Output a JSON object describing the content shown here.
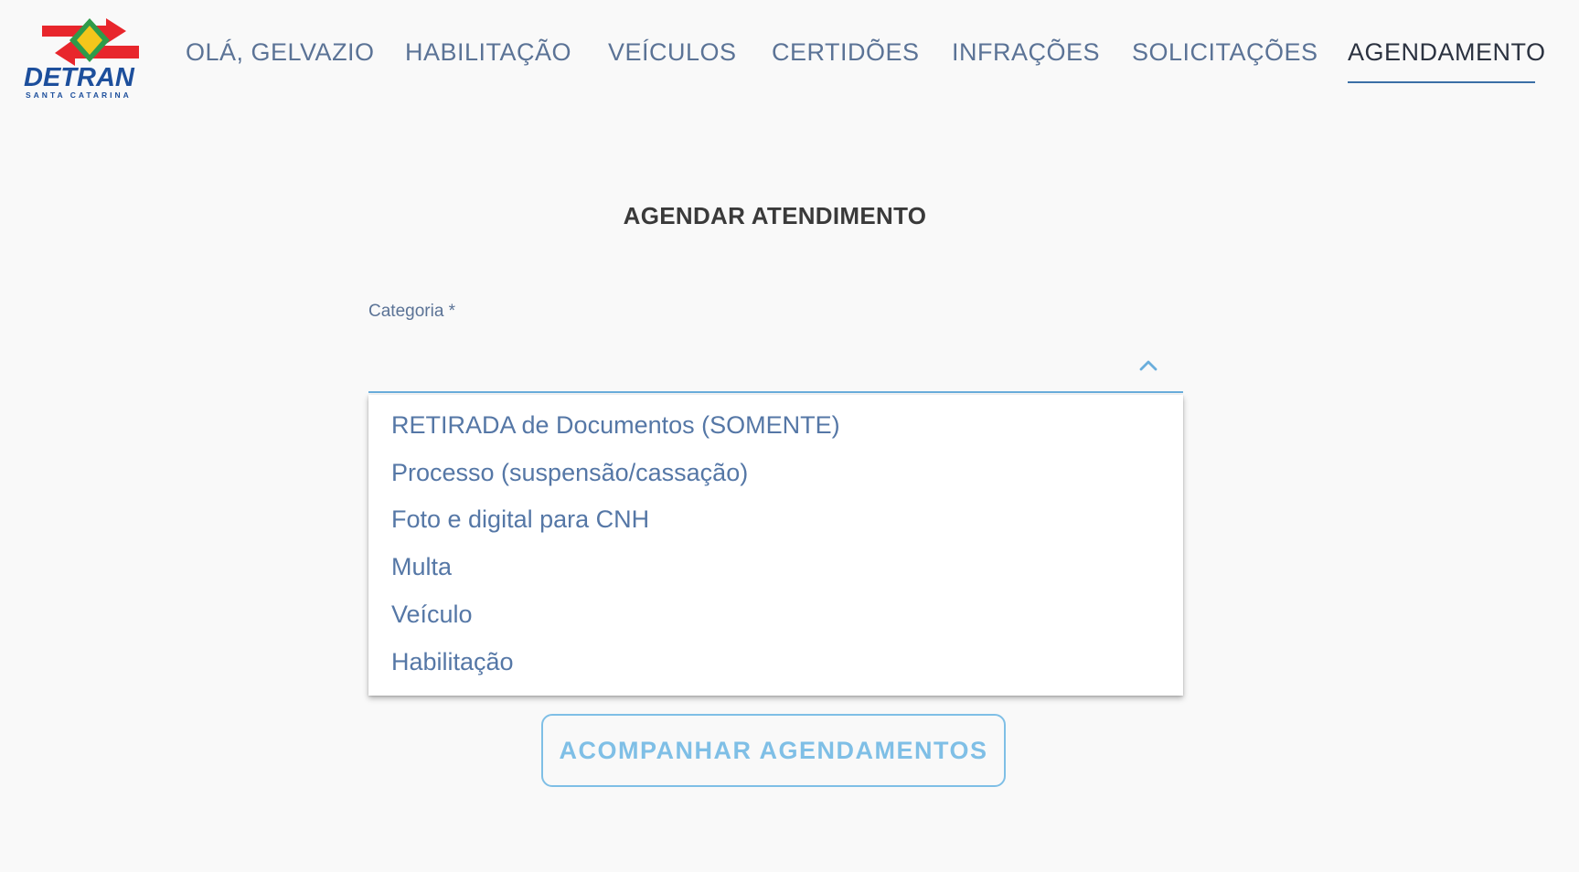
{
  "header": {
    "logo": {
      "brand_text": "DETRAN",
      "subtitle_text": "SANTA CATARINA"
    },
    "nav": {
      "items": [
        {
          "label": "OLÁ, GELVAZIO"
        },
        {
          "label": "HABILITAÇÃO"
        },
        {
          "label": "VEÍCULOS"
        },
        {
          "label": "CERTIDÕES"
        },
        {
          "label": "INFRAÇÕES"
        },
        {
          "label": "SOLICITAÇÕES"
        },
        {
          "label": "AGENDAMENTO"
        }
      ],
      "active": "AGENDAMENTO"
    }
  },
  "main": {
    "title": "AGENDAR ATENDIMENTO",
    "category_select": {
      "label": "Categoria *",
      "value": "",
      "expanded": true,
      "options": [
        "RETIRADA de Documentos (SOMENTE)",
        "Processo (suspensão/cassação)",
        "Foto e digital para CNH",
        "Multa",
        "Veículo",
        "Habilitação"
      ]
    },
    "track_button": {
      "label": "ACOMPANHAR AGENDAMENTOS"
    }
  },
  "colors": {
    "background": "#f9f9f9",
    "nav_text": "#5b7396",
    "nav_active_text": "#2b3240",
    "nav_active_underline": "#3b6fa6",
    "option_text": "#5577a6",
    "select_underline": "#6aaedc",
    "button_accent": "#7fbfe6",
    "logo_red": "#e8262c",
    "logo_green": "#2e9b4a",
    "logo_yellow": "#f4c61b",
    "logo_blue": "#1d4f9c"
  }
}
